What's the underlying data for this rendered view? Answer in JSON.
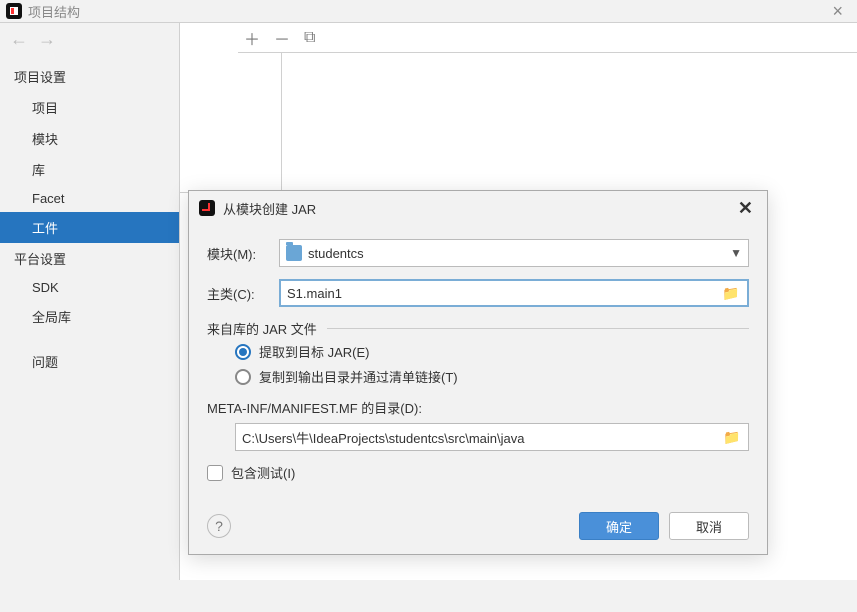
{
  "window": {
    "title": "项目结构"
  },
  "sidebar": {
    "section0": "项目设置",
    "items0": [
      {
        "label": "项目"
      },
      {
        "label": "模块"
      },
      {
        "label": "库"
      },
      {
        "label": "Facet"
      },
      {
        "label": "工件"
      }
    ],
    "section1": "平台设置",
    "items1": [
      {
        "label": "SDK"
      },
      {
        "label": "全局库"
      }
    ],
    "section2": "问题"
  },
  "dialog": {
    "title": "从模块创建 JAR",
    "module_label": "模块(M):",
    "module_value": "studentcs",
    "mainclass_label": "主类(C):",
    "mainclass_value": "S1.main1",
    "jarlib_label": "来自库的 JAR 文件",
    "radio_extract": "提取到目标 JAR(E)",
    "radio_copy": "复制到输出目录并通过清单链接(T)",
    "meta_label": "META-INF/MANIFEST.MF 的目录(D):",
    "meta_value": "C:\\Users\\牛\\IdeaProjects\\studentcs\\src\\main\\java",
    "inc_tests": "包含测试(I)",
    "ok": "确定",
    "cancel": "取消",
    "help": "?"
  }
}
